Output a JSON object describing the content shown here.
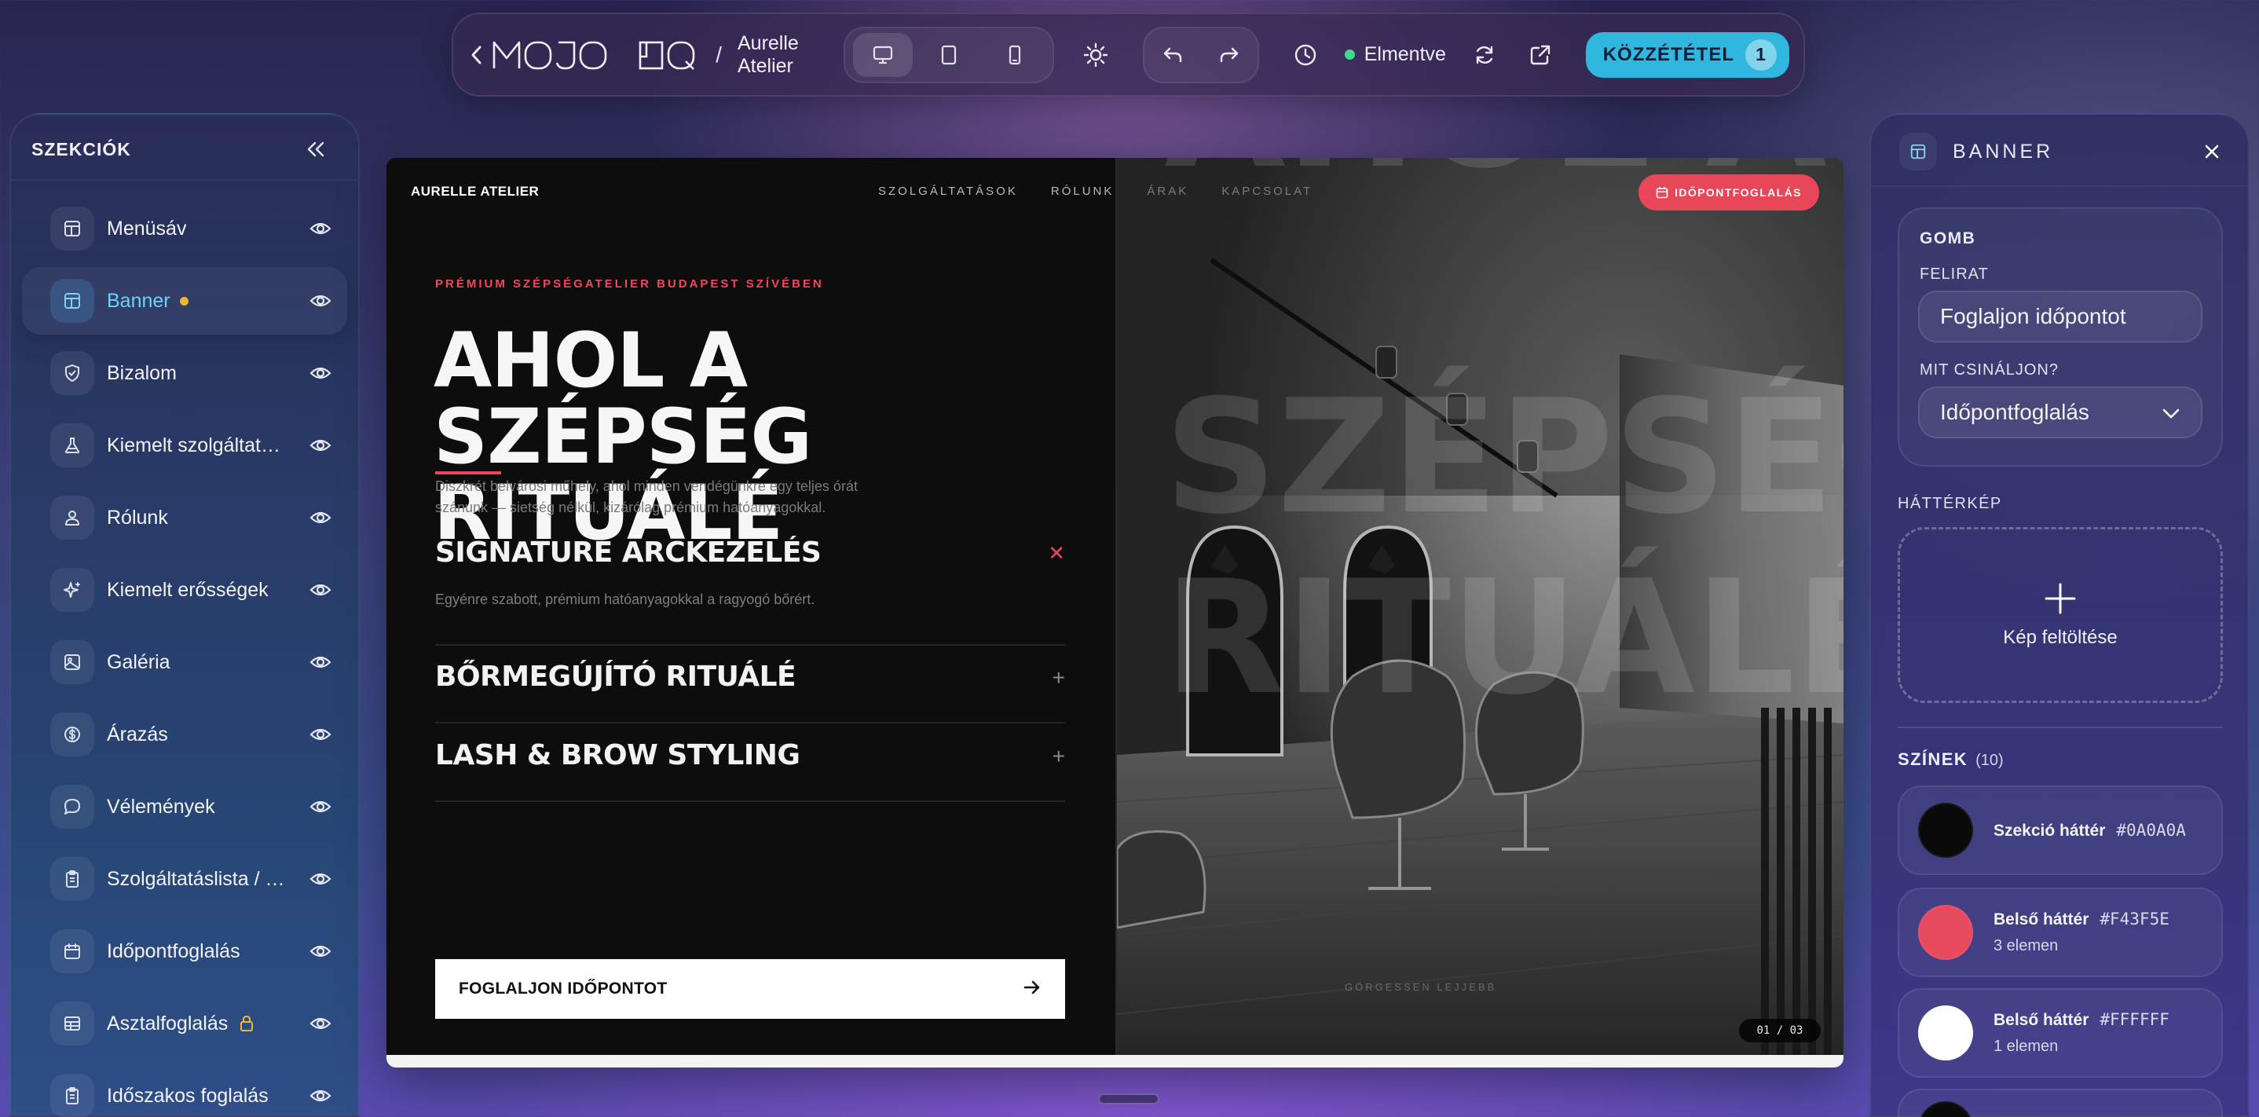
{
  "toolbar": {
    "back_icon": "chevron-left-icon",
    "separator": "/",
    "project_name": "Aurelle Atelier",
    "devices": [
      "desktop-icon",
      "tablet-icon",
      "mobile-icon"
    ],
    "status_text": "Elmentve",
    "publish_label": "KÖZZÉTÉTEL",
    "publish_count": "1",
    "status_color": "#42D78F",
    "accent_color": "#2FB7DE"
  },
  "sidebar": {
    "title": "SZEKCIÓK",
    "items": [
      {
        "label": "Menüsáv",
        "icon": "layout-icon"
      },
      {
        "label": "Banner",
        "icon": "layout-icon",
        "active": true,
        "modified": true
      },
      {
        "label": "Bizalom",
        "icon": "shield-icon"
      },
      {
        "label": "Kiemelt szolgáltatások",
        "icon": "flask-icon"
      },
      {
        "label": "Rólunk",
        "icon": "person-icon"
      },
      {
        "label": "Kiemelt erősségek",
        "icon": "sparkle-icon"
      },
      {
        "label": "Galéria",
        "icon": "image-icon"
      },
      {
        "label": "Árazás",
        "icon": "dollar-icon"
      },
      {
        "label": "Vélemények",
        "icon": "chat-icon"
      },
      {
        "label": "Szolgáltatáslista / Étlap",
        "icon": "clipboard-icon"
      },
      {
        "label": "Időpontfoglalás",
        "icon": "calendar-icon"
      },
      {
        "label": "Asztalfoglalás",
        "icon": "table-icon",
        "locked": true
      },
      {
        "label": "Időszakos foglalás",
        "icon": "clipboard-icon"
      }
    ]
  },
  "preview": {
    "brand": "AURELLE ATELIER",
    "nav": [
      "SZOLGÁLTATÁSOK",
      "RÓLUNK",
      "ÁRAK",
      "KAPCSOLAT"
    ],
    "book_button": "IDŐPONTFOGLALÁS",
    "eyebrow": "PRÉMIUM SZÉPSÉGATELIER BUDAPEST SZÍVÉBEN",
    "headline_line1": "AHOL A SZÉPSÉG",
    "headline_line2": "RITUÁLÉ",
    "lead": "Diszkrét belvárosi műhely, ahol minden vendégünkre egy teljes órát szánunk — sietség nélkül, kizárólag prémium hatóanyagokkal.",
    "accordion": [
      {
        "title": "SIGNATURE ARCKEZELÉS",
        "description": "Egyénre szabott, prémium hatóanyagokkal a ragyogó bőrért.",
        "open": true
      },
      {
        "title": "BŐRMEGÚJÍTÓ RITUÁLÉ",
        "open": false
      },
      {
        "title": "LASH & BROW STYLING",
        "open": false
      }
    ],
    "cta_label": "FOGLALJON IDŐPONTOT",
    "bg_word_1": "SZÉPSÉG",
    "bg_word_2": "RITUÁLÉ",
    "bg_word_top": "AHOL A",
    "scroll_hint": "GÖRGESSEN LEJJEBB",
    "slide_counter": "01 / 03"
  },
  "panel": {
    "title": "BANNER",
    "button_group": {
      "title": "GOMB",
      "caption_label": "FELIRAT",
      "caption_value": "Foglaljon időpontot",
      "action_label": "MIT CSINÁLJON?",
      "action_value": "Időpontfoglalás"
    },
    "bg_image_label": "HÁTTÉRKÉP",
    "upload_label": "Kép feltöltése",
    "colors_title": "SZÍNEK",
    "colors_count": "(10)",
    "colors": [
      {
        "name": "Szekció háttér",
        "hex": "#0A0A0A",
        "count": ""
      },
      {
        "name": "Belső háttér",
        "hex": "#F43F5E",
        "count": "3 elemen"
      },
      {
        "name": "Belső háttér",
        "hex": "#FFFFFF",
        "count": "1 elemen"
      }
    ]
  }
}
